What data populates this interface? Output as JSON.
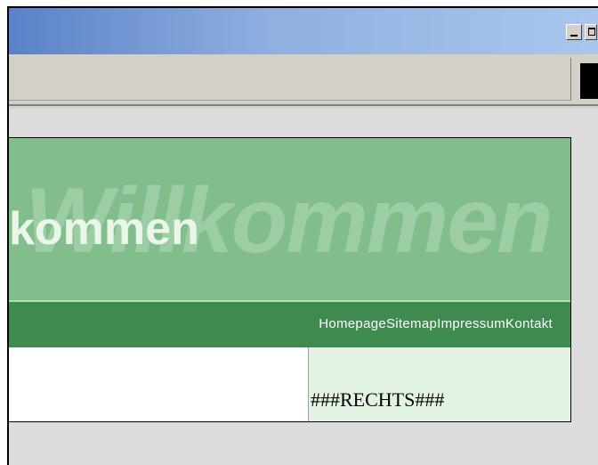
{
  "window": {
    "title": ""
  },
  "banner": {
    "background_text": "Willkommen",
    "foreground_text": "kommen",
    "background_color": "#81be8c",
    "navbar_color": "#3e8a4f"
  },
  "nav": {
    "items": [
      {
        "label": "Homepage"
      },
      {
        "label": "Sitemap"
      },
      {
        "label": "Impressum"
      },
      {
        "label": "Kontakt"
      }
    ]
  },
  "content": {
    "right_placeholder": "###RECHTS###",
    "right_background": "#e2f3e4"
  }
}
